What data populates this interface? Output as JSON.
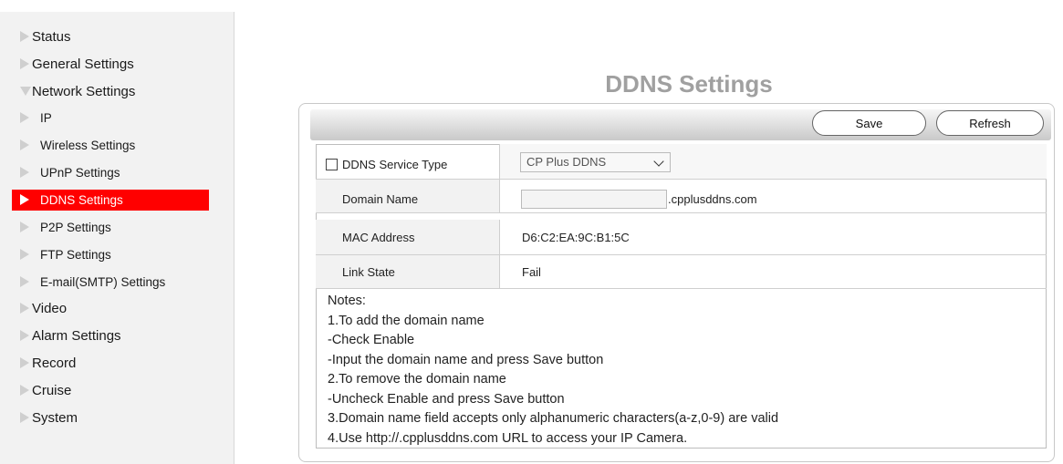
{
  "sidebar": {
    "items": [
      {
        "label": "Status",
        "level": "top",
        "state": "collapsed"
      },
      {
        "label": "General Settings",
        "level": "top",
        "state": "collapsed"
      },
      {
        "label": "Network Settings",
        "level": "top",
        "state": "expanded"
      },
      {
        "label": "IP",
        "level": "sub"
      },
      {
        "label": "Wireless Settings",
        "level": "sub"
      },
      {
        "label": "UPnP Settings",
        "level": "sub"
      },
      {
        "label": "DDNS Settings",
        "level": "sub",
        "active": true
      },
      {
        "label": "P2P Settings",
        "level": "sub"
      },
      {
        "label": "FTP Settings",
        "level": "sub"
      },
      {
        "label": "E-mail(SMTP) Settings",
        "level": "sub"
      },
      {
        "label": "Video",
        "level": "top",
        "state": "collapsed"
      },
      {
        "label": "Alarm Settings",
        "level": "top",
        "state": "collapsed"
      },
      {
        "label": "Record",
        "level": "top",
        "state": "collapsed"
      },
      {
        "label": "Cruise",
        "level": "top",
        "state": "collapsed"
      },
      {
        "label": "System",
        "level": "top",
        "state": "collapsed"
      }
    ],
    "active_color": "#ff0000"
  },
  "main": {
    "title": "DDNS Settings",
    "toolbar": {
      "save_label": "Save",
      "refresh_label": "Refresh"
    },
    "form": {
      "service_type_label": "DDNS Service Type",
      "service_type_checked": false,
      "service_type_value": "CP Plus DDNS",
      "domain_name_label": "Domain Name",
      "domain_name_value": "",
      "domain_suffix": ".cpplusddns.com",
      "mac_label": "MAC Address",
      "mac_value": "D6:C2:EA:9C:B1:5C",
      "link_state_label": "Link State",
      "link_state_value": "Fail"
    },
    "notes": [
      "Notes:",
      "1.To add the domain name",
      "-Check Enable",
      "-Input the domain name and press Save button",
      "2.To remove the domain name",
      "-Uncheck Enable and press Save button",
      "3.Domain name field accepts only alphanumeric characters(a-z,0-9) are valid",
      "4.Use http://.cpplusddns.com URL to access your IP Camera."
    ]
  }
}
